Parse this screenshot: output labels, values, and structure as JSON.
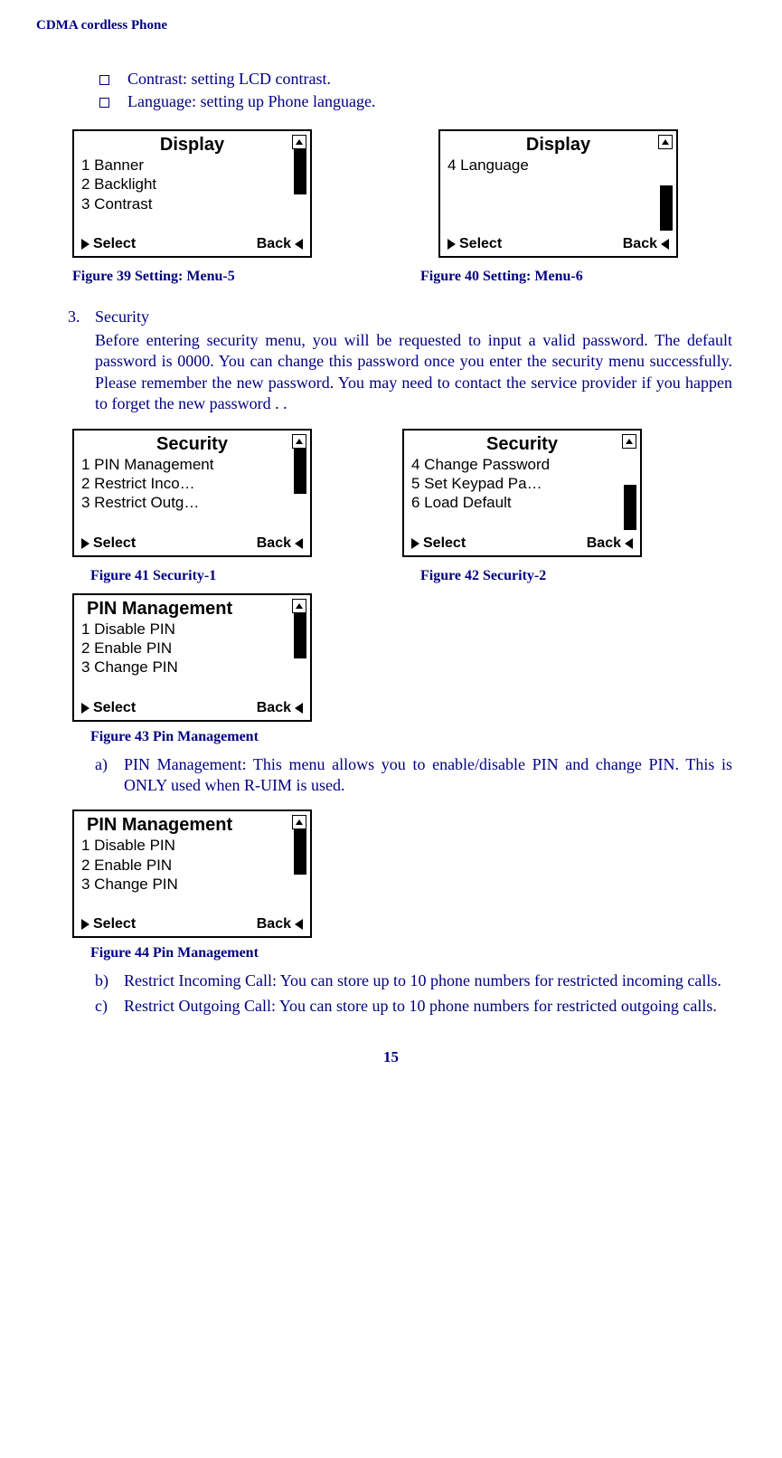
{
  "header": "CDMA cordless Phone",
  "bullets": {
    "b1": "Contrast: setting LCD contrast.",
    "b2": "Language: setting up Phone language."
  },
  "lcd": {
    "display1": {
      "title": "Display",
      "l1": "1 Banner",
      "l2": "2 Backlight",
      "l3": "3 Contrast",
      "select": "Select",
      "back": "Back"
    },
    "display2": {
      "title": "Display",
      "l1": "4 Language",
      "select": "Select",
      "back": "Back"
    },
    "security1": {
      "title": "Security",
      "l1": "1 PIN Management",
      "l2": "2 Restrict Inco…",
      "l3": "3 Restrict Outg…",
      "select": "Select",
      "back": "Back"
    },
    "security2": {
      "title": "Security",
      "l1": "4 Change Password",
      "l2": "5 Set Keypad Pa…",
      "l3": "6  Load Default",
      "select": "Select",
      "back": "Back"
    },
    "pin1": {
      "title": "PIN Management",
      "l1": "1 Disable PIN",
      "l2": "2 Enable  PIN",
      "l3": "3 Change PIN",
      "select": "Select",
      "back": "Back"
    },
    "pin2": {
      "title": "PIN Management",
      "l1": "1 Disable PIN",
      "l2": "2 Enable  PIN",
      "l3": "3 Change PIN",
      "select": "Select",
      "back": "Back"
    }
  },
  "captions": {
    "fig39": "Figure 39 Setting: Menu-5",
    "fig40": "Figure 40 Setting: Menu-6",
    "fig41": "Figure 41 Security-1",
    "fig42": "Figure 42 Security-2",
    "fig43": "Figure 43 Pin Management",
    "fig44": "Figure 44 Pin Management"
  },
  "sections": {
    "n3": "3.",
    "n3_title": "Security",
    "n3_body": "Before entering security menu, you will be requested to input a valid password. The default password is 0000. You can change this password once you enter the security menu successfully. Please remember the new password.  You may need to contact the service provider if you happen to forget the new password . ."
  },
  "lettered": {
    "a_l": "a)",
    "a_t": "PIN Management: This menu allows you to enable/disable PIN and change PIN.  This is ONLY used when R-UIM is used.",
    "b_l": "b)",
    "b_t": "Restrict Incoming Call: You can store up to 10 phone numbers  for restricted incoming calls.",
    "c_l": "c)",
    "c_t": "Restrict Outgoing Call: You can store up to 10 phone numbers  for restricted outgoing calls."
  },
  "page": "15"
}
